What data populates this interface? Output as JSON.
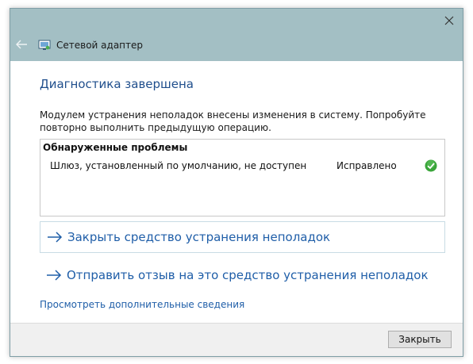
{
  "window": {
    "title": "Сетевой адаптер",
    "icons": {
      "back": "back-arrow-icon",
      "app": "network-adapter-icon",
      "close": "close-icon"
    }
  },
  "main": {
    "heading": "Диагностика завершена",
    "description": "Модулем устранения неполадок внесены изменения в систему. Попробуйте повторно выполнить предыдущую операцию.",
    "problems": {
      "header": "Обнаруженные проблемы",
      "rows": [
        {
          "name": "Шлюз, установленный по умолчанию, не доступен",
          "status": "Исправлено",
          "icon": "check-icon"
        }
      ]
    },
    "links": [
      {
        "label": "Закрыть средство устранения неполадок",
        "icon": "arrow-right-icon"
      },
      {
        "label": "Отправить отзыв на это средство устранения неполадок",
        "icon": "arrow-right-icon"
      }
    ],
    "more_info": "Просмотреть дополнительные сведения"
  },
  "footer": {
    "close_label": "Закрыть"
  },
  "colors": {
    "titlebar": "#a3bfc4",
    "heading": "#1f4e8c",
    "link": "#1f5ea8",
    "check": "#3aa53a"
  }
}
